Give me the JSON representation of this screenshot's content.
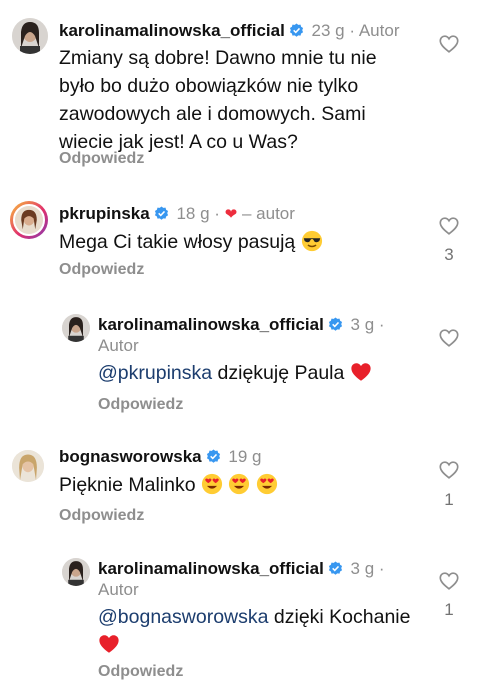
{
  "comments": [
    {
      "username": "karolinamalinowska_official",
      "time": "23 g",
      "separator": "·",
      "author_label": "Autor",
      "text_lines": [
        "Zmiany są dobre!  Dawno mnie tu nie",
        "było bo dużo obowiązków nie tylko",
        "zawodowych ale i domowych. Sami",
        "wiecie jak jest! A co u Was?"
      ],
      "reply_label": "Odpowiedz",
      "likes": ""
    },
    {
      "username": "pkrupinska",
      "time": "18 g",
      "separator": "·",
      "author_label": "– autor",
      "text": "Mega Ci takie włosy pasują",
      "reply_label": "Odpowiedz",
      "likes": "3"
    },
    {
      "username": "karolinamalinowska_official",
      "time": "3 g",
      "separator": "·",
      "author_label": "Autor",
      "mention": "@pkrupinska",
      "text": " dziękuję Paula",
      "reply_label": "Odpowiedz",
      "likes": ""
    },
    {
      "username": "bognasworowska",
      "time": "19 g",
      "text": "Pięknie Malinko",
      "reply_label": "Odpowiedz",
      "likes": "1"
    },
    {
      "username": "karolinamalinowska_official",
      "time": "3 g",
      "separator": "·",
      "author_label": "Autor",
      "mention": "@bognasworowska",
      "text": " dzięki Kochanie",
      "reply_label": "Odpowiedz",
      "likes": "1"
    }
  ],
  "colors": {
    "verified": "#3897f0",
    "heart": "#ed2d3d",
    "muted": "#8e8e8e",
    "mention": "#1c3d6e"
  }
}
